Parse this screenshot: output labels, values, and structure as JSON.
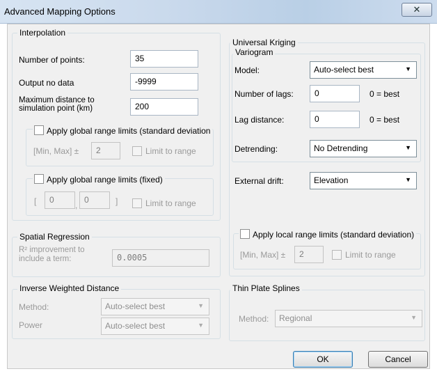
{
  "window": {
    "title": "Advanced Mapping Options",
    "close_glyph": "✕"
  },
  "interpolation": {
    "title": "Interpolation",
    "num_points_label": "Number of points:",
    "num_points_value": "35",
    "output_no_data_label": "Output no data",
    "output_no_data_value": "-9999",
    "max_distance_label_line1": "Maximum distance to",
    "max_distance_label_line2": "simulation point (km)",
    "max_distance_value": "200",
    "global_std": {
      "checkbox_label": "Apply global range limits (standard deviation",
      "minmax_label": "[Min, Max] ±",
      "value": "2",
      "limit_label": "Limit to range"
    },
    "global_fixed": {
      "checkbox_label": "Apply global range limits (fixed)",
      "open_bracket": "[",
      "min_value": "0",
      "comma": ",",
      "max_value": "0",
      "close_bracket": "]",
      "limit_label": "Limit to range"
    }
  },
  "universal_kriging": {
    "title": "Universal Kriging",
    "variogram": {
      "title": "Variogram",
      "model_label": "Model:",
      "model_value": "Auto-select best",
      "num_lags_label": "Number of lags:",
      "num_lags_value": "0",
      "num_lags_hint": "0 = best",
      "lag_distance_label": "Lag distance:",
      "lag_distance_value": "0",
      "lag_distance_hint": "0 = best",
      "detrending_label": "Detrending:",
      "detrending_value": "No Detrending"
    },
    "external_drift_label": "External drift:",
    "external_drift_value": "Elevation",
    "local_std": {
      "checkbox_label": "Apply local range limits (standard deviation)",
      "minmax_label": "[Min, Max] ±",
      "value": "2",
      "limit_label": "Limit to range"
    }
  },
  "spatial_regression": {
    "title": "Spatial Regression",
    "r2_label_line1": "R² improvement to",
    "r2_label_line2": "include a term:",
    "r2_value": "0.0005"
  },
  "idw": {
    "title": "Inverse Weighted Distance",
    "method_label": "Method:",
    "method_value": "Auto-select best",
    "power_label": "Power",
    "power_value": "Auto-select best"
  },
  "tps": {
    "title": "Thin Plate Splines",
    "method_label": "Method:",
    "method_value": "Regional"
  },
  "buttons": {
    "ok": "OK",
    "cancel": "Cancel"
  },
  "icons": {
    "dropdown_arrow": "▼",
    "dropdown_arrow_disabled": "▼"
  }
}
